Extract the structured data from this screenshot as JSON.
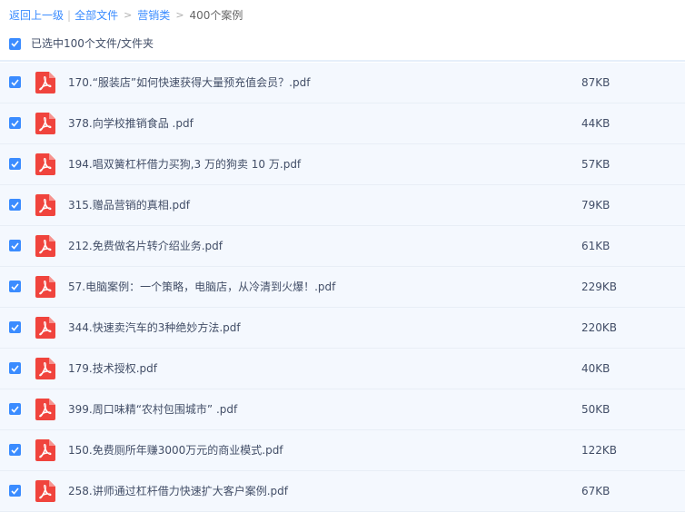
{
  "breadcrumb": {
    "back": "返回上一级",
    "separator": "|",
    "all_files": "全部文件",
    "arrow": ">",
    "category": "营销类",
    "current": "400个案例"
  },
  "selection": {
    "label": "已选中100个文件/文件夹",
    "checked": true
  },
  "colors": {
    "accent": "#3b8cff",
    "row_bg": "#f4f8fe",
    "pdf_red": "#f0443d"
  },
  "files": [
    {
      "name": "170.“服装店”如何快速获得大量预充值会员？.pdf",
      "size": "87KB",
      "icon": "pdf-icon",
      "checked": true
    },
    {
      "name": "378.向学校推销食品 .pdf",
      "size": "44KB",
      "icon": "pdf-icon",
      "checked": true
    },
    {
      "name": "194.唱双簧杠杆借力买狗,3 万的狗卖 10 万.pdf",
      "size": "57KB",
      "icon": "pdf-icon",
      "checked": true
    },
    {
      "name": "315.赠品营销的真相.pdf",
      "size": "79KB",
      "icon": "pdf-icon",
      "checked": true
    },
    {
      "name": "212.免费做名片转介绍业务.pdf",
      "size": "61KB",
      "icon": "pdf-icon",
      "checked": true
    },
    {
      "name": "57.电脑案例：一个策略，电脑店，从冷清到火爆！.pdf",
      "size": "229KB",
      "icon": "pdf-icon",
      "checked": true
    },
    {
      "name": "344.快速卖汽车的3种绝妙方法.pdf",
      "size": "220KB",
      "icon": "pdf-icon",
      "checked": true
    },
    {
      "name": "179.技术授权.pdf",
      "size": "40KB",
      "icon": "pdf-icon",
      "checked": true
    },
    {
      "name": "399.周口味精“农村包围城市” .pdf",
      "size": "50KB",
      "icon": "pdf-icon",
      "checked": true
    },
    {
      "name": "150.免费厕所年赚3000万元的商业模式.pdf",
      "size": "122KB",
      "icon": "pdf-icon",
      "checked": true
    },
    {
      "name": "258.讲师通过杠杆借力快速扩大客户案例.pdf",
      "size": "67KB",
      "icon": "pdf-icon",
      "checked": true
    }
  ]
}
